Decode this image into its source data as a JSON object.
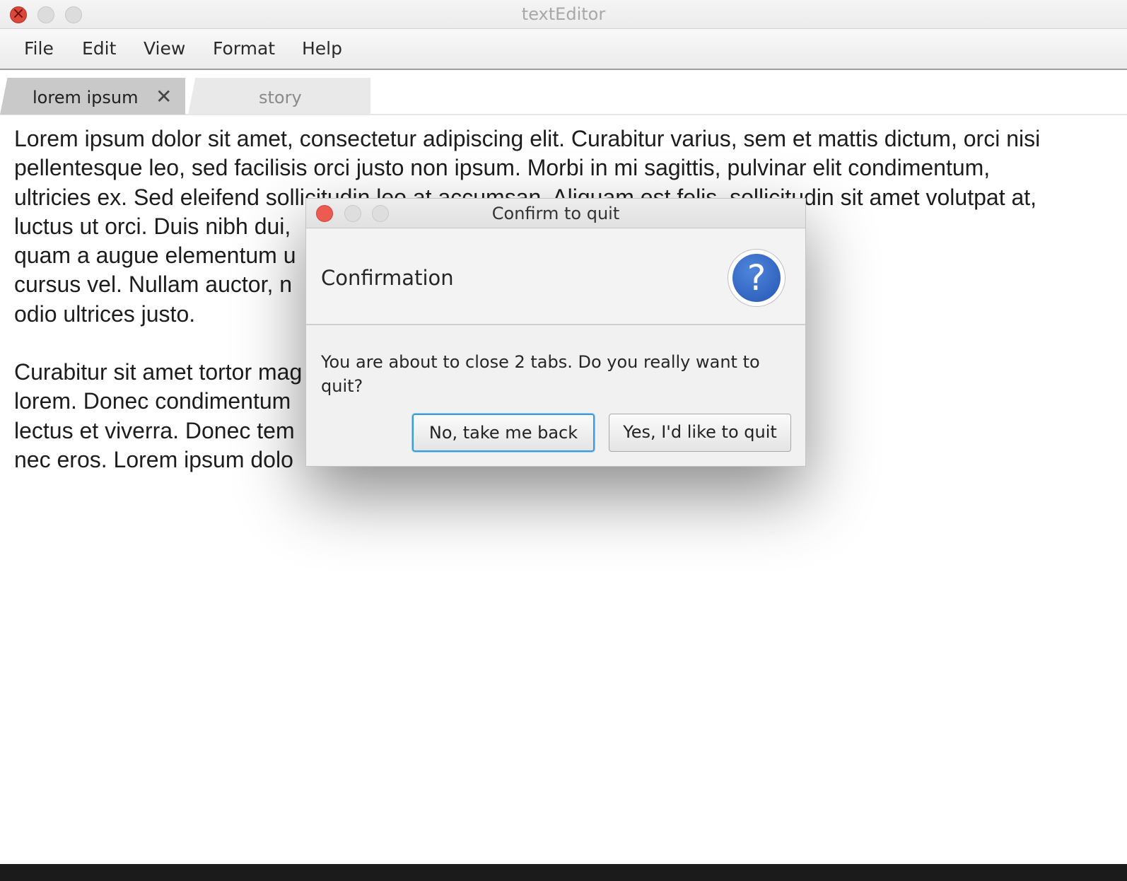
{
  "window": {
    "title": "textEditor"
  },
  "menubar": {
    "items": [
      "File",
      "Edit",
      "View",
      "Format",
      "Help"
    ]
  },
  "tabs": [
    {
      "label": "lorem ipsum",
      "close": "✕"
    },
    {
      "label": "story"
    }
  ],
  "document": {
    "paragraphs": [
      "Lorem ipsum dolor sit amet, consectetur adipiscing elit. Curabitur varius, sem et mattis dictum, orci nisi pellentesque leo, sed facilisis orci justo non ipsum. Morbi in mi sagittis, pulvinar elit condimentum, ultricies ex. Sed eleifend sollicitudin leo at accumsan. Aliquam est felis, sollicitudin sit amet volutpat at, luctus ut orci. Duis nibh dui, [obscured] rhoncus purus. Curabitur eu quam a augue elementum u[obscured] turpis, quis luctus leo cursus vel. Nullam auctor, n[obscured]s tortor, in porttitor nulla odio ultrices justo.",
      "Curabitur sit amet tortor ma[obscured]um. Phasellus non posuere lorem. Donec condimentum [obscured]c accumsan imperdiet lectus et viverra. Donec tem[obscured]nte ornare vestibulum eget nec eros. Lorem ipsum dolo[obscured]"
    ],
    "visible_lines": [
      "Lorem ipsum dolor sit amet, consectetur adipiscing elit. Curabitur varius, sem et mattis dictum, orci nisi",
      "pellentesque leo, sed facilisis orci justo non ipsum. Morbi in mi sagittis, pulvinar elit condimentum,",
      "ultricies ex. Sed eleifend sollicitudin leo at accumsan. Aliquam est felis, sollicitudin sit amet volutpat at,",
      "luctus ut orci. Duis nibh dui,",
      "quam a augue elementum u",
      "cursus vel. Nullam auctor, n",
      "odio ultrices justo.",
      "Curabitur sit amet tortor mag",
      "lorem. Donec condimentum",
      "lectus et viverra. Donec tem",
      "nec eros. Lorem ipsum dolo"
    ]
  },
  "dialog": {
    "title": "Confirm to quit",
    "heading": "Confirmation",
    "icon": "help-question-icon",
    "message": "You are about to close 2 tabs. Do you really want to quit?",
    "buttons": {
      "cancel": "No, take me back",
      "confirm": "Yes, I'd like to quit"
    }
  },
  "colors": {
    "close_red": "#d9483a",
    "dialog_close_red": "#ed5a52",
    "focus_blue": "#3a9bd8",
    "help_icon_blue": "#2f63c4"
  }
}
